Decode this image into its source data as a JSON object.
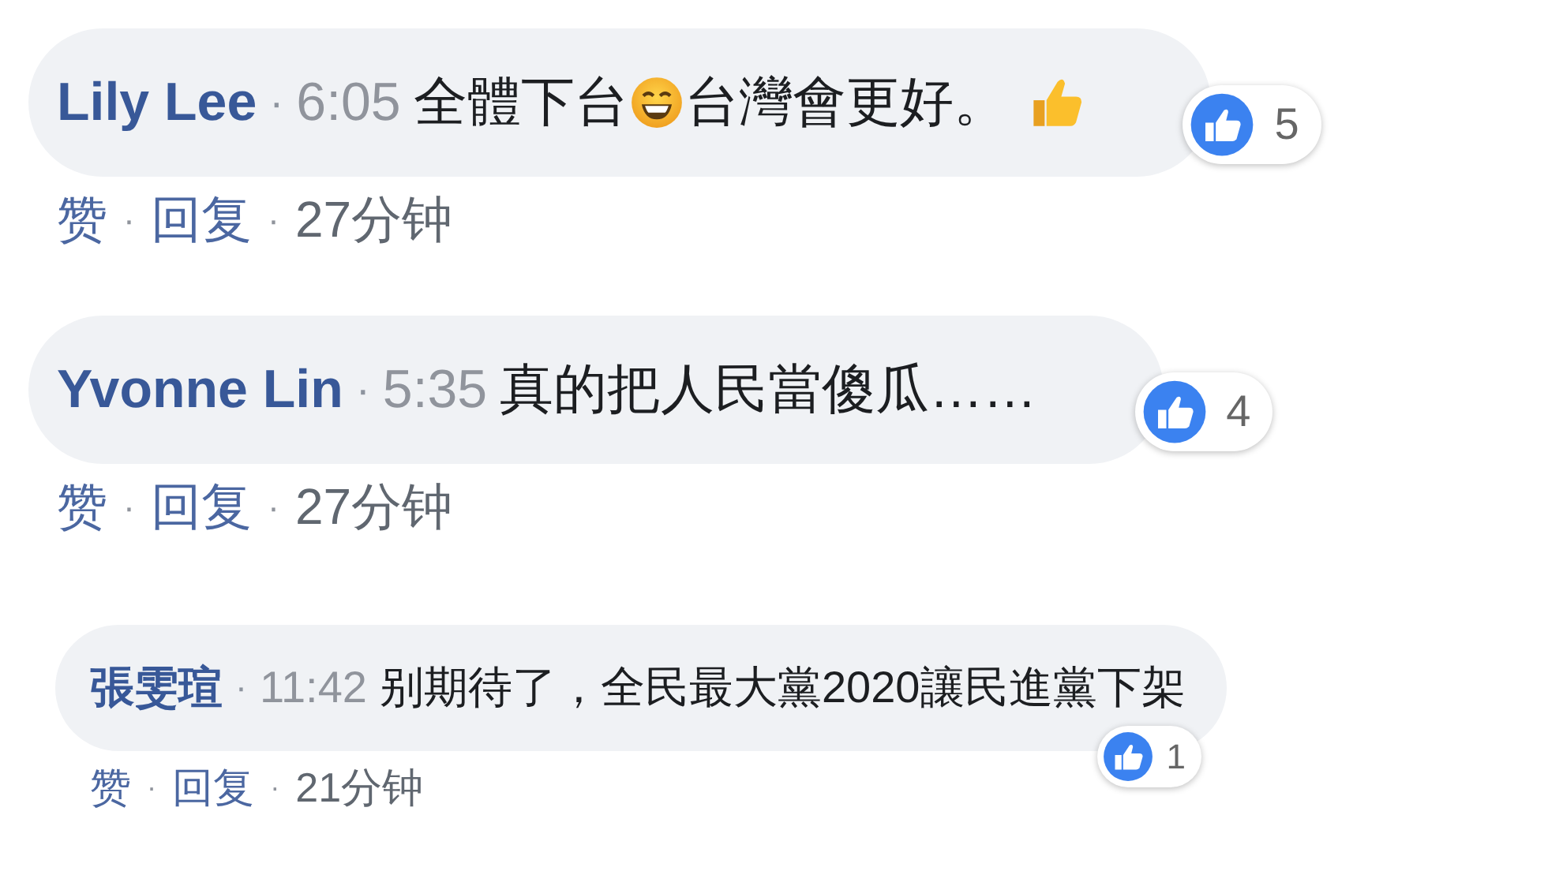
{
  "comments": [
    {
      "kind": "large",
      "author": "Lily Lee",
      "dot": "·",
      "time": "6:05",
      "body": [
        {
          "kind": "text",
          "text": "全體下台"
        },
        {
          "kind": "grin"
        },
        {
          "kind": "text",
          "text": "台灣會更好。"
        },
        {
          "kind": "thumb"
        }
      ],
      "reactions": "5",
      "actions": [
        {
          "kind": "link",
          "text": "赞"
        },
        {
          "kind": "dot",
          "text": "·"
        },
        {
          "kind": "link",
          "text": "回复"
        },
        {
          "kind": "dot",
          "text": "·"
        },
        {
          "kind": "time",
          "text": "27分钟"
        }
      ]
    },
    {
      "kind": "large",
      "author": "Yvonne Lin",
      "dot": "·",
      "time": "5:35",
      "body": [
        {
          "kind": "text",
          "text": "真的把人民當傻瓜……"
        }
      ],
      "reactions": "4",
      "actions": [
        {
          "kind": "link",
          "text": "赞"
        },
        {
          "kind": "dot",
          "text": "·"
        },
        {
          "kind": "link",
          "text": "回复"
        },
        {
          "kind": "dot",
          "text": "·"
        },
        {
          "kind": "time",
          "text": "27分钟"
        }
      ]
    },
    {
      "kind": "compact",
      "author": "張雯瑄",
      "dot": "·",
      "time": "11:42",
      "body": [
        {
          "kind": "text",
          "text": "别期待了，全民最大黨2020讓民進黨下架"
        }
      ],
      "reactions": "1",
      "actions": [
        {
          "kind": "link",
          "text": "赞"
        },
        {
          "kind": "dot",
          "text": "·"
        },
        {
          "kind": "link",
          "text": "回复"
        },
        {
          "kind": "dot",
          "text": "·"
        },
        {
          "kind": "time",
          "text": "21分钟"
        }
      ]
    }
  ]
}
